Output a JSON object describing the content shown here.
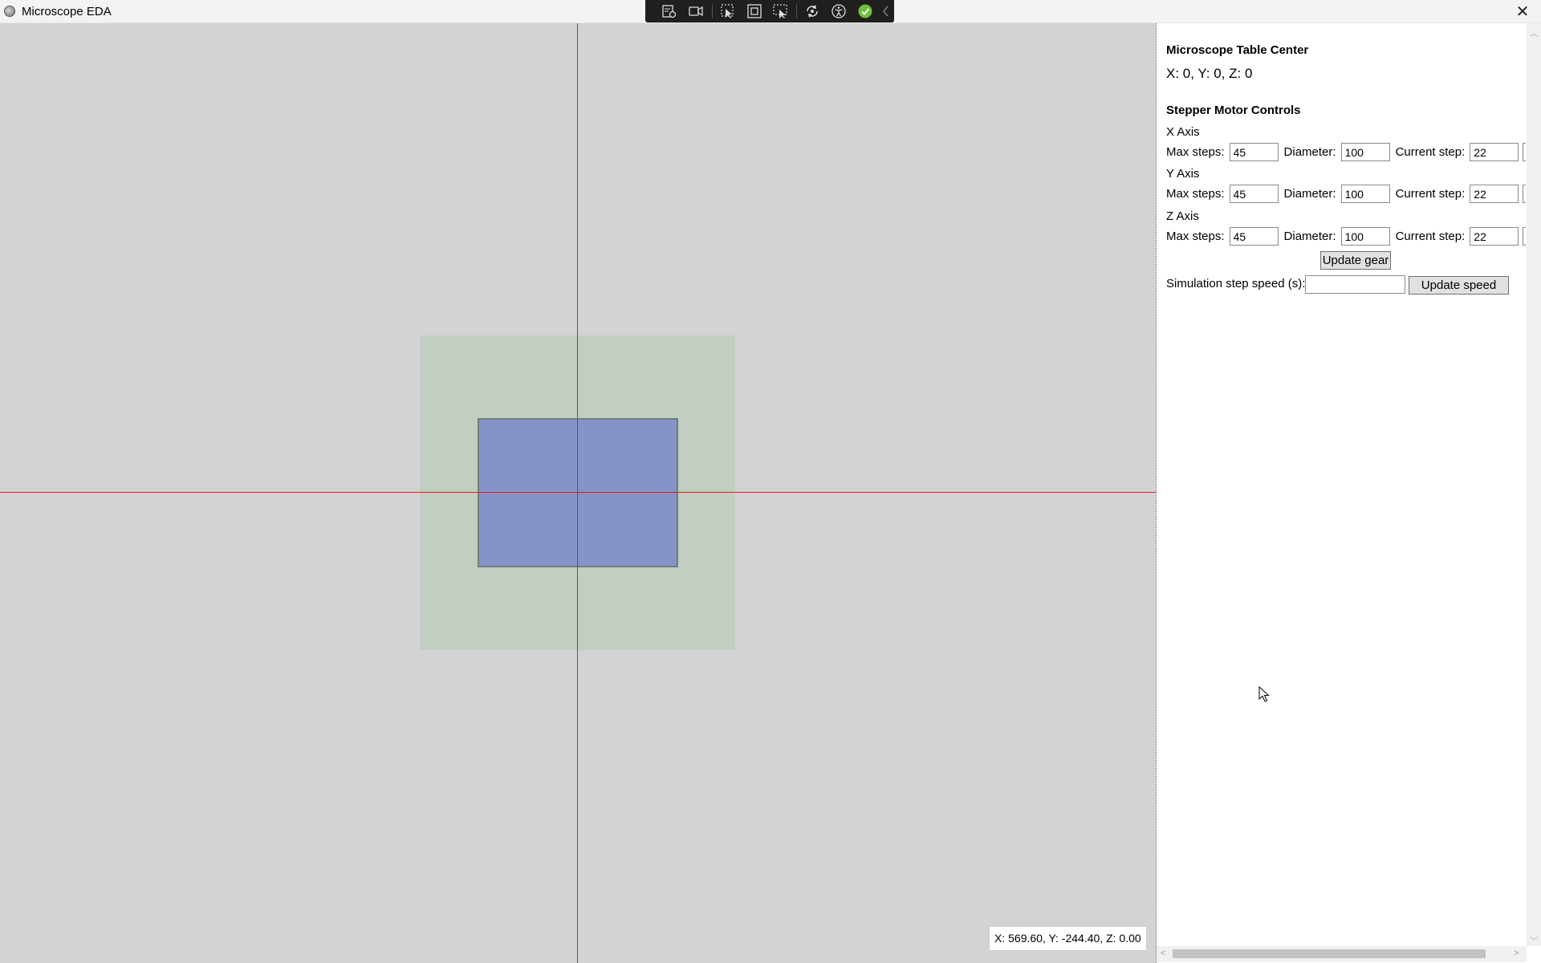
{
  "window": {
    "title": "Microscope EDA",
    "close_glyph": "✕"
  },
  "debug_toolbar": {
    "icons": [
      "live-visual-tree-icon",
      "video-record-icon",
      "select-element-icon",
      "display-layout-adorners-icon",
      "track-focus-icon",
      "hot-reload-icon",
      "accessibility-icon",
      "binding-ok-icon",
      "collapse-toolbar-icon"
    ]
  },
  "canvas": {
    "background": "#d3d3d3",
    "range_color": "#c2cec2",
    "table_color": "#8594c8",
    "crosshair_color": "#e2201c",
    "coordinates": "X: 569.60, Y: -244.40, Z: 0.00"
  },
  "panel": {
    "table_center": {
      "title": "Microscope Table Center",
      "value": "X: 0, Y: 0, Z: 0"
    },
    "stepper": {
      "title": "Stepper Motor Controls",
      "max_steps_label": "Max steps:",
      "diameter_label": "Diameter:",
      "current_step_label": "Current step:",
      "axes": [
        {
          "name": "X Axis",
          "max_steps": "45",
          "diameter": "100",
          "current_step": "22"
        },
        {
          "name": "Y Axis",
          "max_steps": "45",
          "diameter": "100",
          "current_step": "22"
        },
        {
          "name": "Z Axis",
          "max_steps": "45",
          "diameter": "100",
          "current_step": "22"
        }
      ],
      "update_gear_label": "Update gear"
    },
    "simulation": {
      "label": "Simulation step speed (s):",
      "value": "",
      "update_speed_label": "Update speed"
    }
  }
}
